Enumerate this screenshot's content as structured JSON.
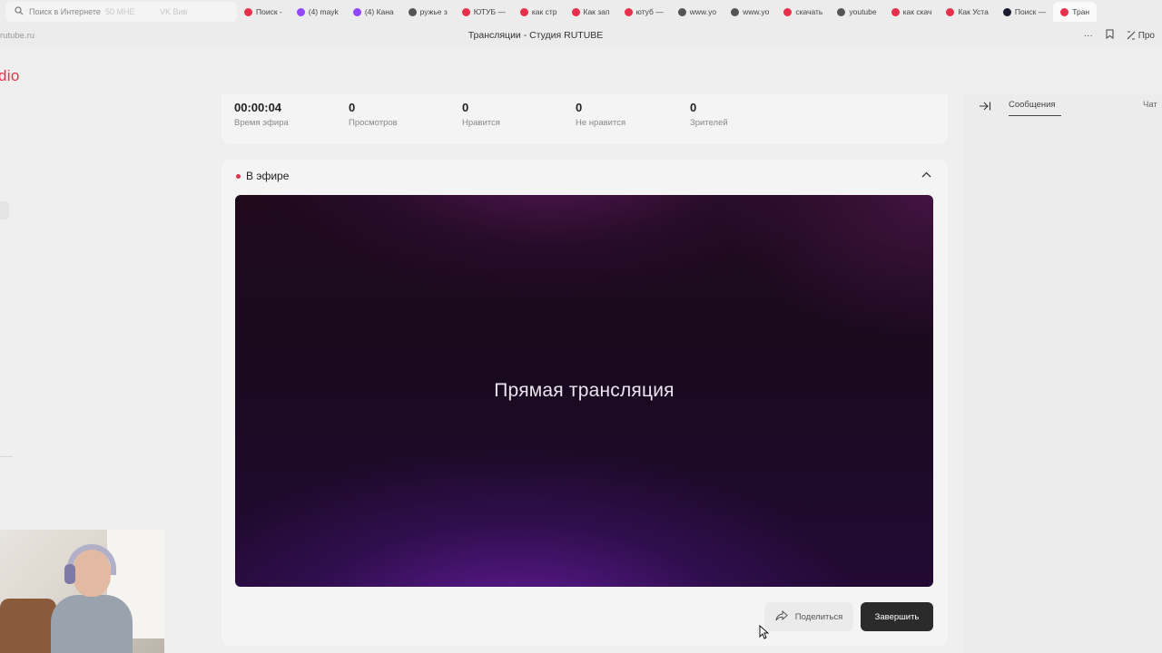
{
  "browser": {
    "search_placeholder": "Поиск в Интернете",
    "search_faded": "50 МНЕ",
    "search_faded2": "VK Вив",
    "tabs": [
      {
        "label": "Поиск -",
        "color": "#e8304a"
      },
      {
        "label": "(4) mayk",
        "color": "#9146ff"
      },
      {
        "label": "(4) Кана",
        "color": "#9146ff"
      },
      {
        "label": "ружье з",
        "color": "#555555"
      },
      {
        "label": "ЮТУБ —",
        "color": "#e8304a"
      },
      {
        "label": "как стр",
        "color": "#e8304a"
      },
      {
        "label": "Как зап",
        "color": "#e8304a"
      },
      {
        "label": "ютуб —",
        "color": "#e8304a"
      },
      {
        "label": "www.yo",
        "color": "#555555"
      },
      {
        "label": "www.yo",
        "color": "#555555"
      },
      {
        "label": "скачать",
        "color": "#e8304a"
      },
      {
        "label": "youtube",
        "color": "#555555"
      },
      {
        "label": "как скач",
        "color": "#e8304a"
      },
      {
        "label": "Как Уста",
        "color": "#e8304a"
      },
      {
        "label": "Поиск —",
        "color": "#1a1a2e"
      },
      {
        "label": "Тран",
        "color": "#e8304a"
      }
    ],
    "url": "rutube.ru",
    "page_title": "Трансляции - Студия RUTUBE",
    "more_label": "···",
    "pro_label": "Про"
  },
  "sidebar": {
    "logo_text": "dio"
  },
  "stats": [
    {
      "value": "00:00:04",
      "label": "Время эфира"
    },
    {
      "value": "0",
      "label": "Просмотров"
    },
    {
      "value": "0",
      "label": "Нравится"
    },
    {
      "value": "0",
      "label": "Не нравится"
    },
    {
      "value": "0",
      "label": "Зрителей"
    }
  ],
  "live": {
    "status": "В эфире",
    "player_text": "Прямая трансляция",
    "share_label": "Поделиться",
    "end_label": "Завершить"
  },
  "right_panel": {
    "tab_messages": "Сообщения",
    "tab_chat": "Чат"
  },
  "colors": {
    "accent": "#e8304a",
    "end_button": "#2b2b2b"
  }
}
